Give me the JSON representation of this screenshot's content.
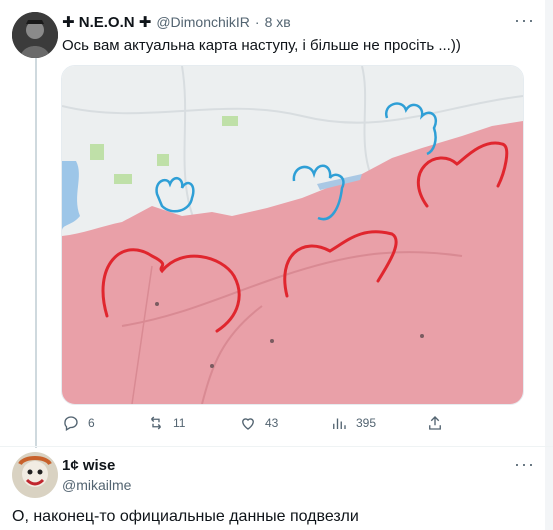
{
  "tweet1": {
    "display_name": "✚ N.E.O.N ✚",
    "handle": "@DimonchikIR",
    "separator": "·",
    "time": "8 хв",
    "text": "Ось вам актуальна карта наступу, і більше не просіть ...))",
    "actions": {
      "reply_count": "6",
      "retweet_count": "11",
      "like_count": "43",
      "view_count": "395"
    }
  },
  "tweet2": {
    "display_name": "1¢ wise",
    "handle": "@mikailme",
    "text": "О, наконец-то официальные данные подвезли"
  },
  "colors": {
    "map_land": "#eceff0",
    "occupied": "#e9a0a8",
    "red_stroke": "#e0262e",
    "blue_stroke": "#2f9fd6",
    "water": "#9dc6e8"
  }
}
